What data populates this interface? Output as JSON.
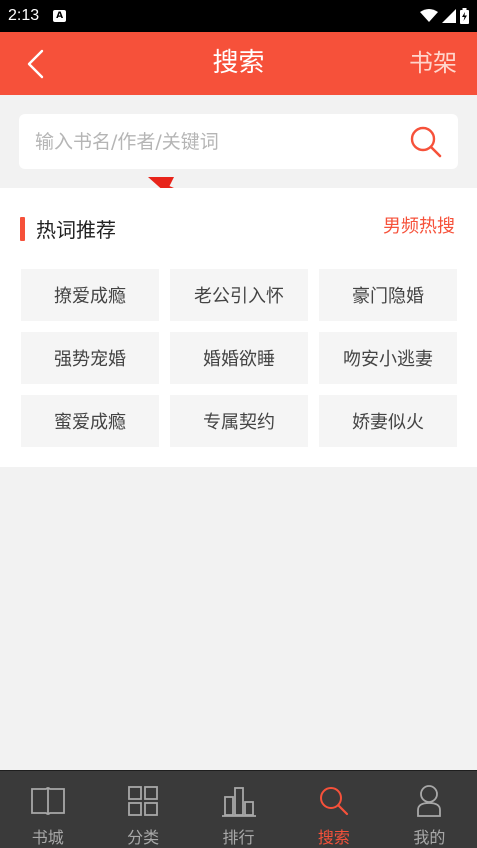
{
  "status_bar": {
    "time": "2:13",
    "notification_glyph": "A"
  },
  "header": {
    "title": "搜索",
    "shelf_label": "书架"
  },
  "search": {
    "placeholder": "输入书名/作者/关键词",
    "value": ""
  },
  "hot": {
    "title": "热词推荐",
    "switch_label": "男频热搜",
    "tags": [
      "撩爱成瘾",
      "老公引入怀",
      "豪门隐婚",
      "强势宠婚",
      "婚婚欲睡",
      "吻安小逃妻",
      "蜜爱成瘾",
      "专属契约",
      "娇妻似火"
    ]
  },
  "tabbar": {
    "items": [
      {
        "label": "书城",
        "icon": "book-icon"
      },
      {
        "label": "分类",
        "icon": "grid-icon"
      },
      {
        "label": "排行",
        "icon": "ranking-icon"
      },
      {
        "label": "搜索",
        "icon": "search-icon"
      },
      {
        "label": "我的",
        "icon": "profile-icon"
      }
    ],
    "active_index": 3
  },
  "colors": {
    "accent": "#f6513a",
    "tabbar_bg": "#3a3a3a",
    "page_bg": "#f2f2f2"
  }
}
